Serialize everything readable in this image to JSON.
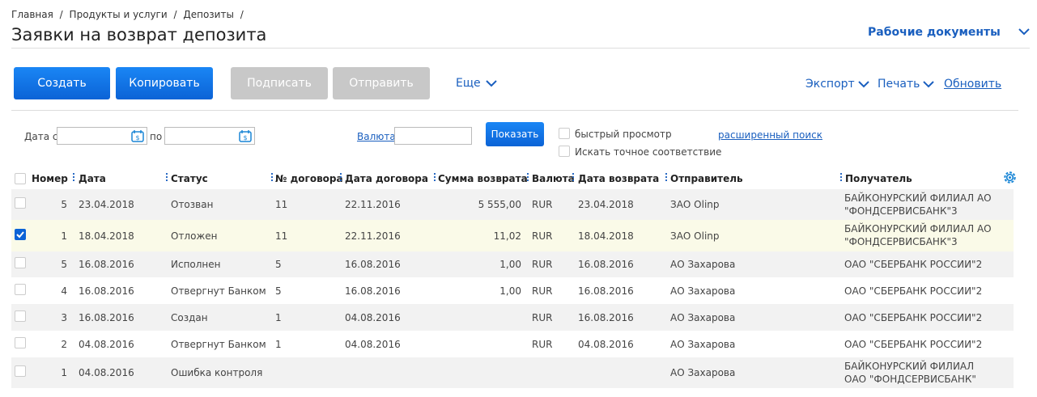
{
  "breadcrumb": [
    "Главная",
    "/",
    "Продукты и услуги",
    "/",
    "Депозиты",
    "/"
  ],
  "page_title": "Заявки на возврат депозита",
  "work_docs": "Рабочие документы",
  "toolbar": {
    "create": "Создать",
    "copy": "Копировать",
    "sign": "Подписать",
    "send": "Отправить",
    "more": "Еще",
    "export": "Экспорт",
    "print": "Печать",
    "refresh": "Обновить"
  },
  "filters": {
    "date_from_label": "Дата с",
    "date_to_label": "по",
    "currency_label": "Валюта",
    "show": "Показать",
    "quick_view": "быстрый просмотр",
    "exact_match": "Искать точное соответствие",
    "advanced_search": "расширенный поиск"
  },
  "columns": [
    "Номер",
    "Дата",
    "Статус",
    "№ договора",
    "Дата договора",
    "Сумма возврата",
    "Валюта",
    "Дата возврата",
    "Отправитель",
    "Получатель"
  ],
  "rows": [
    {
      "num": "5",
      "date": "23.04.2018",
      "status": "Отозван",
      "contract": "11",
      "contract_date": "22.11.2016",
      "amount": "5 555,00",
      "currency": "RUR",
      "return_date": "23.04.2018",
      "sender": "ЗАО Olinp",
      "receiver": "БАЙКОНУРСКИЙ ФИЛИАЛ АО \"ФОНДСЕРВИСБАНК\"3",
      "checked": false
    },
    {
      "num": "1",
      "date": "18.04.2018",
      "status": "Отложен",
      "contract": "11",
      "contract_date": "22.11.2016",
      "amount": "11,02",
      "currency": "RUR",
      "return_date": "18.04.2018",
      "sender": "ЗАО Olinp",
      "receiver": "БАЙКОНУРСКИЙ ФИЛИАЛ АО \"ФОНДСЕРВИСБАНК\"3",
      "checked": true
    },
    {
      "num": "5",
      "date": "16.08.2016",
      "status": "Исполнен",
      "contract": "5",
      "contract_date": "16.08.2016",
      "amount": "1,00",
      "currency": "RUR",
      "return_date": "16.08.2016",
      "sender": "АО Захарова",
      "receiver": "ОАО \"СБЕРБАНК РОССИИ\"2",
      "checked": false
    },
    {
      "num": "4",
      "date": "16.08.2016",
      "status": "Отвергнут Банком",
      "contract": "5",
      "contract_date": "16.08.2016",
      "amount": "1,00",
      "currency": "RUR",
      "return_date": "16.08.2016",
      "sender": "АО Захарова",
      "receiver": "ОАО \"СБЕРБАНК РОССИИ\"2",
      "checked": false
    },
    {
      "num": "3",
      "date": "16.08.2016",
      "status": "Создан",
      "contract": "1",
      "contract_date": "04.08.2016",
      "amount": "",
      "currency": "RUR",
      "return_date": "16.08.2016",
      "sender": "АО Захарова",
      "receiver": "ОАО \"СБЕРБАНК РОССИИ\"2",
      "checked": false
    },
    {
      "num": "2",
      "date": "04.08.2016",
      "status": "Отвергнут Банком",
      "contract": "1",
      "contract_date": "04.08.2016",
      "amount": "",
      "currency": "RUR",
      "return_date": "04.08.2016",
      "sender": "АО Захарова",
      "receiver": "ОАО \"СБЕРБАНК РОССИИ\"2",
      "checked": false
    },
    {
      "num": "1",
      "date": "04.08.2016",
      "status": "Ошибка контроля",
      "contract": "",
      "contract_date": "",
      "amount": "",
      "currency": "",
      "return_date": "",
      "sender": "АО Захарова",
      "receiver": "БАЙКОНУРСКИЙ ФИЛИАЛ ОАО \"ФОНДСЕРВИСБАНК\"",
      "checked": false
    }
  ],
  "colors": {
    "accent": "#0b63d6",
    "link": "#1a5fbf"
  }
}
